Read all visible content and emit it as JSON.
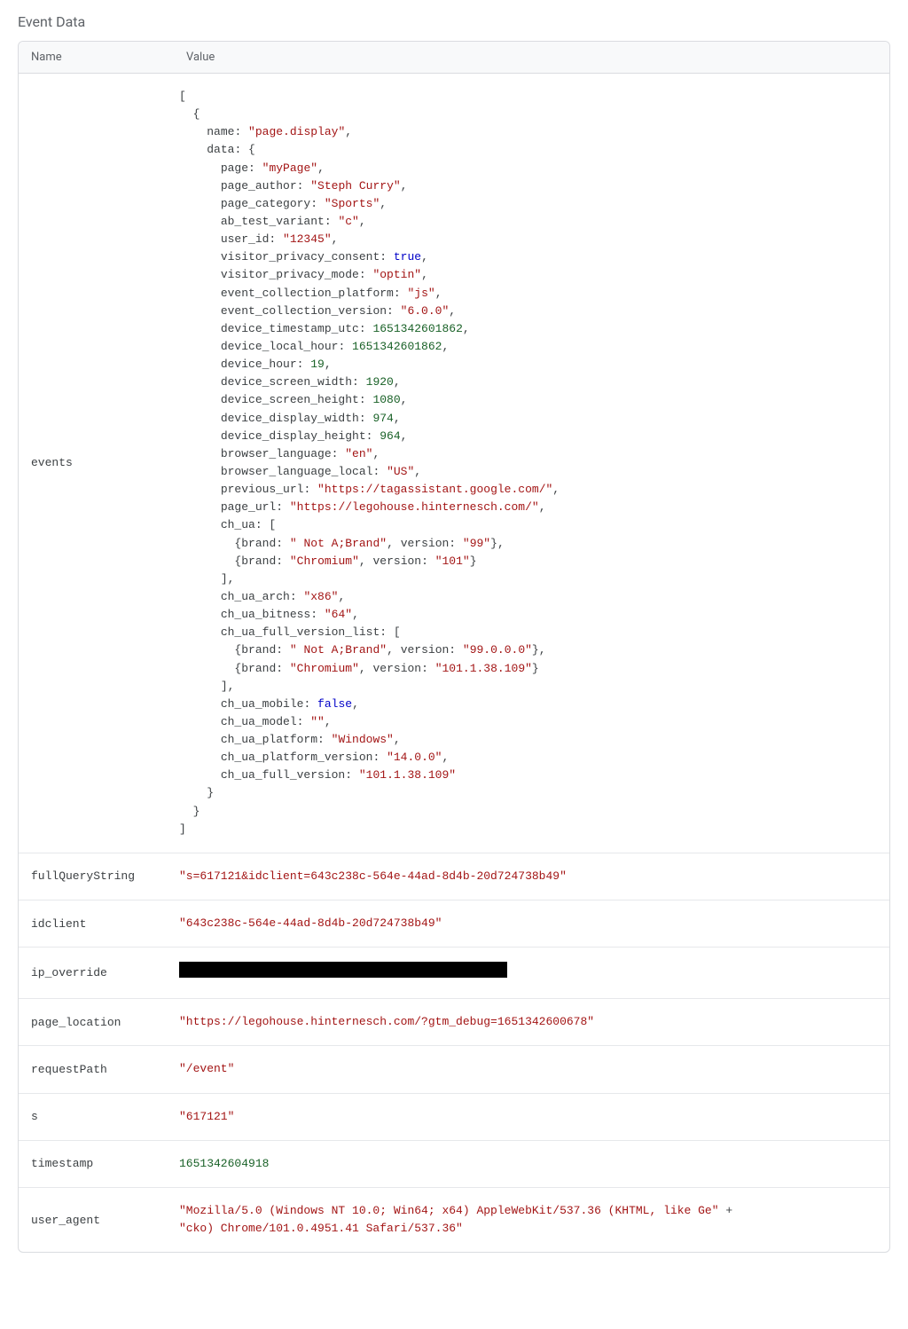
{
  "section_title": "Event Data",
  "columns": {
    "name": "Name",
    "value": "Value"
  },
  "events_row_name": "events",
  "events_payload": {
    "name": "page.display",
    "data": {
      "page": "myPage",
      "page_author": "Steph Curry",
      "page_category": "Sports",
      "ab_test_variant": "c",
      "user_id": "12345",
      "visitor_privacy_consent": true,
      "visitor_privacy_mode": "optin",
      "event_collection_platform": "js",
      "event_collection_version": "6.0.0",
      "device_timestamp_utc": 1651342601862,
      "device_local_hour": 1651342601862,
      "device_hour": 19,
      "device_screen_width": 1920,
      "device_screen_height": 1080,
      "device_display_width": 974,
      "device_display_height": 964,
      "browser_language": "en",
      "browser_language_local": "US",
      "previous_url": "https://tagassistant.google.com/",
      "page_url": "https://legohouse.hinternesch.com/",
      "ch_ua": [
        {
          "brand": " Not A;Brand",
          "version": "99"
        },
        {
          "brand": "Chromium",
          "version": "101"
        }
      ],
      "ch_ua_arch": "x86",
      "ch_ua_bitness": "64",
      "ch_ua_full_version_list": [
        {
          "brand": " Not A;Brand",
          "version": "99.0.0.0"
        },
        {
          "brand": "Chromium",
          "version": "101.1.38.109"
        }
      ],
      "ch_ua_mobile": false,
      "ch_ua_model": "",
      "ch_ua_platform": "Windows",
      "ch_ua_platform_version": "14.0.0",
      "ch_ua_full_version": "101.1.38.109"
    }
  },
  "rows": [
    {
      "name": "fullQueryString",
      "type": "string",
      "value": "s=617121&idclient=643c238c-564e-44ad-8d4b-20d724738b49"
    },
    {
      "name": "idclient",
      "type": "string",
      "value": "643c238c-564e-44ad-8d4b-20d724738b49"
    },
    {
      "name": "ip_override",
      "type": "redacted",
      "value": ""
    },
    {
      "name": "page_location",
      "type": "string",
      "value": "https://legohouse.hinternesch.com/?gtm_debug=1651342600678"
    },
    {
      "name": "requestPath",
      "type": "string",
      "value": "/event"
    },
    {
      "name": "s",
      "type": "string",
      "value": "617121"
    },
    {
      "name": "timestamp",
      "type": "number",
      "value": 1651342604918
    },
    {
      "name": "user_agent",
      "type": "string_concat",
      "parts": [
        "Mozilla/5.0 (Windows NT 10.0; Win64; x64) AppleWebKit/537.36 (KHTML, like Ge",
        "cko) Chrome/101.0.4951.41 Safari/537.36"
      ]
    }
  ]
}
